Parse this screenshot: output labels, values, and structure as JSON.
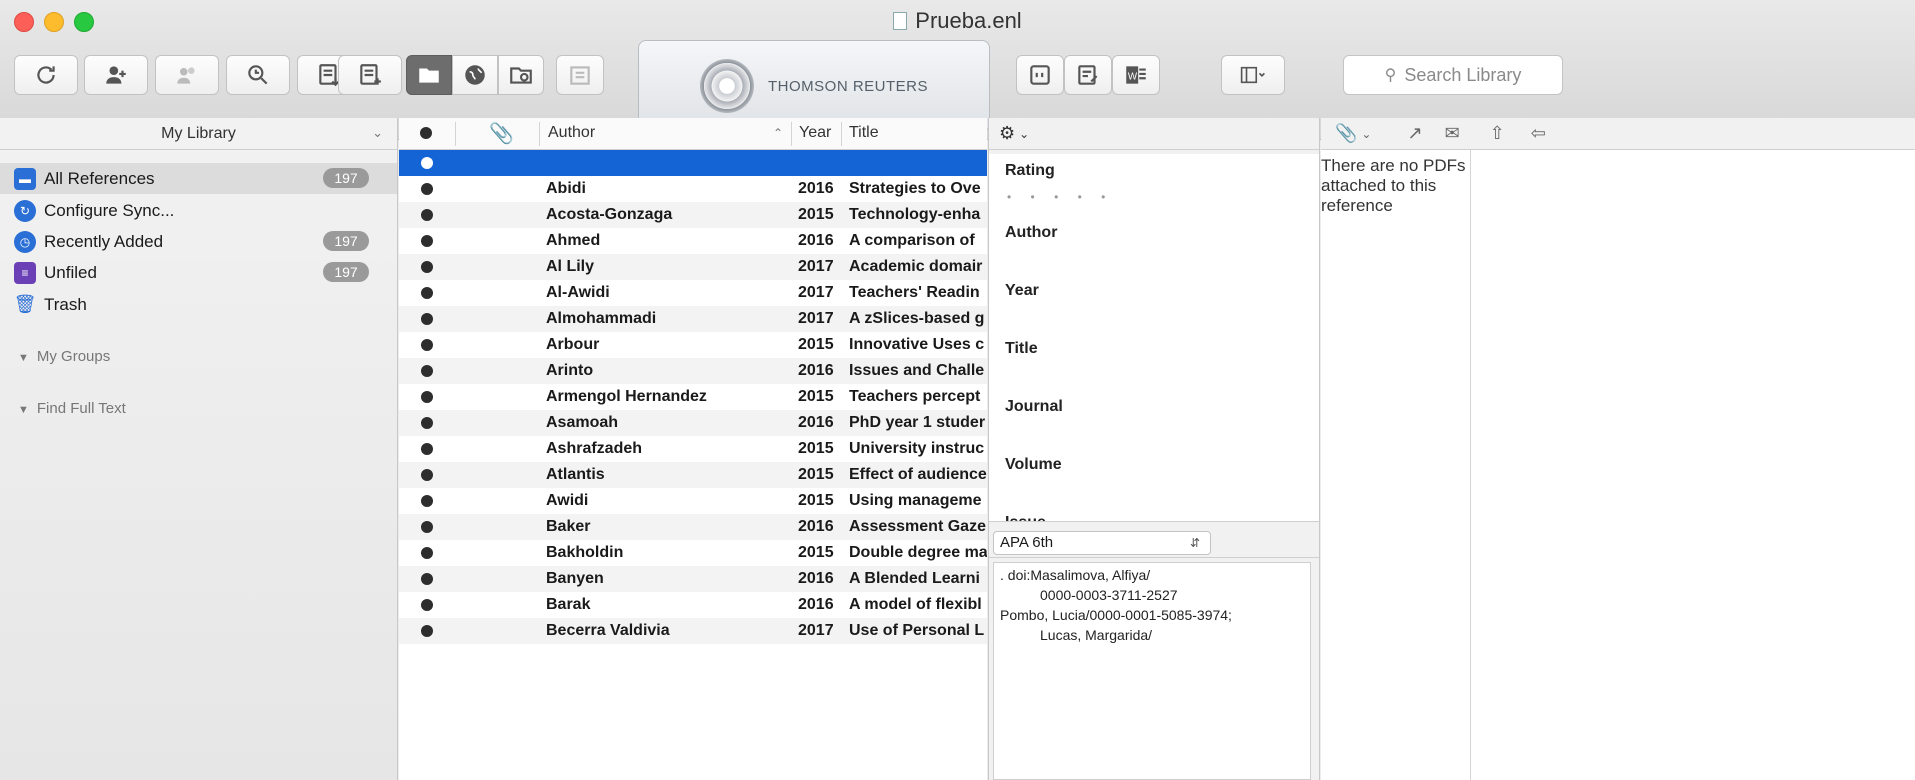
{
  "window": {
    "title": "Prueba.enl"
  },
  "brand": {
    "name": "THOMSON REUTERS"
  },
  "search": {
    "placeholder": "Search Library"
  },
  "sidebar": {
    "header": "My Library",
    "items": [
      {
        "label": "All References",
        "count": "197",
        "icon": "all-references-icon",
        "color": "#2a6fd6"
      },
      {
        "label": "Configure Sync...",
        "count": "",
        "icon": "sync-icon",
        "color": "#2a6fd6"
      },
      {
        "label": "Recently Added",
        "count": "197",
        "icon": "recently-added-icon",
        "color": "#2a6fd6"
      },
      {
        "label": "Unfiled",
        "count": "197",
        "icon": "unfiled-icon",
        "color": "#6b3fb5"
      },
      {
        "label": "Trash",
        "count": "",
        "icon": "trash-icon",
        "color": "#2a6fd6"
      }
    ],
    "groups": [
      "My Groups",
      "Find Full Text"
    ]
  },
  "reflist": {
    "columns": {
      "author": "Author",
      "year": "Year",
      "title": "Title"
    },
    "rows": [
      {
        "author": "",
        "year": "",
        "title": ""
      },
      {
        "author": "Abidi",
        "year": "2016",
        "title": "Strategies to Ove"
      },
      {
        "author": "Acosta-Gonzaga",
        "year": "2015",
        "title": "Technology-enha"
      },
      {
        "author": "Ahmed",
        "year": "2016",
        "title": "A comparison of"
      },
      {
        "author": "Al Lily",
        "year": "2017",
        "title": "Academic domair"
      },
      {
        "author": "Al-Awidi",
        "year": "2017",
        "title": "Teachers' Readin"
      },
      {
        "author": "Almohammadi",
        "year": "2017",
        "title": "A zSlices-based g"
      },
      {
        "author": "Arbour",
        "year": "2015",
        "title": "Innovative Uses c"
      },
      {
        "author": "Arinto",
        "year": "2016",
        "title": "Issues and Challe"
      },
      {
        "author": "Armengol Hernandez",
        "year": "2015",
        "title": "Teachers percept"
      },
      {
        "author": "Asamoah",
        "year": "2016",
        "title": "PhD year 1 studer"
      },
      {
        "author": "Ashrafzadeh",
        "year": "2015",
        "title": "University instruc"
      },
      {
        "author": "Atlantis",
        "year": "2015",
        "title": "Effect of audience"
      },
      {
        "author": "Awidi",
        "year": "2015",
        "title": "Using manageme"
      },
      {
        "author": "Baker",
        "year": "2016",
        "title": "Assessment Gaze"
      },
      {
        "author": "Bakholdin",
        "year": "2015",
        "title": "Double degree ma"
      },
      {
        "author": "Banyen",
        "year": "2016",
        "title": "A Blended Learni"
      },
      {
        "author": "Barak",
        "year": "2016",
        "title": "A model of flexibl"
      },
      {
        "author": "Becerra Valdivia",
        "year": "2017",
        "title": "Use of Personal L"
      }
    ]
  },
  "details": {
    "fields": [
      "Rating",
      "Author",
      "Year",
      "Title",
      "Journal",
      "Volume",
      "Issue"
    ],
    "rating_dots": "• • • • •",
    "style": "APA 6th",
    "preview_lines": [
      ". doi:Masalimova, Alfiya/",
      "0000-0003-3711-2527",
      "Pombo, Lucia/0000-0001-5085-3974;",
      "Lucas, Margarida/"
    ]
  },
  "pdf": {
    "note": "There are no PDFs attached to this reference"
  },
  "toolbar_icons": [
    "sync-icon",
    "find-people-icon",
    "sharing-icon",
    "find-fulltext-icon",
    "import-icon",
    "new-reference-icon",
    "local-library-icon",
    "online-search-icon",
    "integrated-library-icon",
    "groups-icon",
    "insert-citation-icon",
    "format-bibliography-icon",
    "word-icon",
    "layout-icon"
  ]
}
